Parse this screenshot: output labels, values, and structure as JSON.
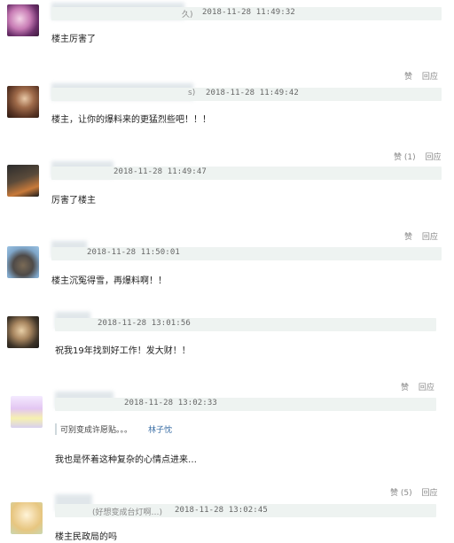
{
  "comments": [
    {
      "name_suffix": "久)",
      "time": "2018-11-28 11:49:32",
      "text": "楼主厉害了",
      "like": "赞",
      "reply": "回应",
      "show_actions": true
    },
    {
      "name_suffix": "s)",
      "time": "2018-11-28 11:49:42",
      "text": "楼主，让你的爆料来的更猛烈些吧！！！",
      "like": "赞 (1)",
      "reply": "回应",
      "show_actions": true
    },
    {
      "name_suffix": "",
      "time": "2018-11-28 11:49:47",
      "text": "厉害了楼主",
      "like": "赞",
      "reply": "回应",
      "show_actions": true
    },
    {
      "name_suffix": "",
      "time": "2018-11-28 11:50:01",
      "text": "楼主沉冤得雪，再爆料啊！！",
      "like": "",
      "reply": "",
      "show_actions": false
    },
    {
      "name_suffix": "",
      "time": "2018-11-28 13:01:56",
      "text": "祝我19年找到好工作！发大财！！",
      "like": "赞",
      "reply": "回应",
      "show_actions": true
    },
    {
      "name_suffix": "",
      "time": "2018-11-28 13:02:33",
      "quote_text": "可别变成许愿贴。。。",
      "quote_name": "林子忱",
      "text": "我也是怀着这种复杂的心情点进来…",
      "like": "赞 (5)",
      "reply": "回应",
      "show_actions": true
    },
    {
      "name_suffix": "(好想变成台灯啊…)",
      "time": "2018-11-28 13:02:45",
      "text": "楼主民政局的吗",
      "like": "",
      "reply": "",
      "show_actions": false
    }
  ]
}
